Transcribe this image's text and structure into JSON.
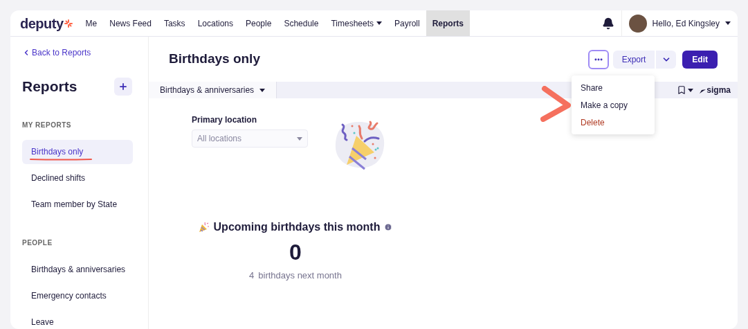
{
  "nav": {
    "logo": "deputy",
    "items": [
      {
        "label": "Me",
        "selected": false,
        "dropdown": false
      },
      {
        "label": "News Feed",
        "selected": false,
        "dropdown": false
      },
      {
        "label": "Tasks",
        "selected": false,
        "dropdown": false
      },
      {
        "label": "Locations",
        "selected": false,
        "dropdown": false
      },
      {
        "label": "People",
        "selected": false,
        "dropdown": false
      },
      {
        "label": "Schedule",
        "selected": false,
        "dropdown": false
      },
      {
        "label": "Timesheets",
        "selected": false,
        "dropdown": true
      },
      {
        "label": "Payroll",
        "selected": false,
        "dropdown": false
      },
      {
        "label": "Reports",
        "selected": true,
        "dropdown": false
      }
    ],
    "greeting": "Hello, Ed Kingsley"
  },
  "sidebar": {
    "back_link": "Back to Reports",
    "title": "Reports",
    "sections": [
      {
        "heading": "MY REPORTS",
        "items": [
          {
            "label": "Birthdays only",
            "selected": true
          },
          {
            "label": "Declined shifts",
            "selected": false
          },
          {
            "label": "Team member by State",
            "selected": false
          }
        ]
      },
      {
        "heading": "PEOPLE",
        "items": [
          {
            "label": "Birthdays & anniversaries",
            "selected": false
          },
          {
            "label": "Emergency contacts",
            "selected": false
          },
          {
            "label": "Leave",
            "selected": false
          }
        ]
      }
    ]
  },
  "header": {
    "title": "Birthdays only",
    "export_button": "Export",
    "edit_button": "Edit"
  },
  "menu": {
    "items": [
      {
        "label": "Share",
        "kind": "normal"
      },
      {
        "label": "Make a copy",
        "kind": "normal"
      },
      {
        "label": "Delete",
        "kind": "danger"
      }
    ]
  },
  "toolbar": {
    "tab": "Birthdays & anniversaries",
    "brand": "sigma"
  },
  "filter": {
    "label": "Primary location",
    "placeholder": "All locations"
  },
  "stat": {
    "title": "Upcoming birthdays this month",
    "value": "0",
    "subtext_count": "4",
    "subtext": "birthdays next month"
  }
}
